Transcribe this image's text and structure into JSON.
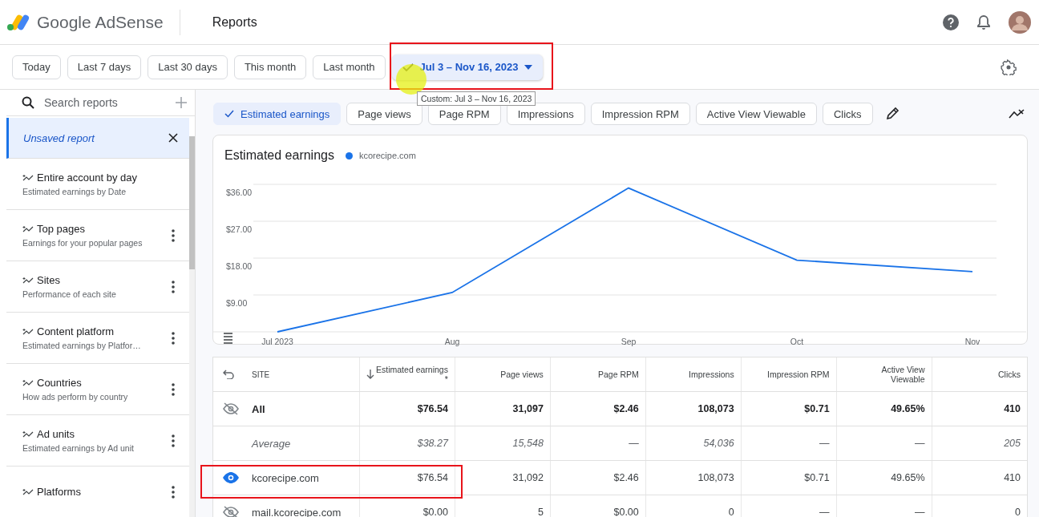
{
  "header": {
    "product_name": "Google AdSense",
    "page_title": "Reports"
  },
  "date_ranges": [
    {
      "label": "Today",
      "kind": "preset",
      "selected": false
    },
    {
      "label": "Last 7 days",
      "kind": "preset",
      "selected": false
    },
    {
      "label": "Last 30 days",
      "kind": "preset",
      "selected": false
    },
    {
      "label": "This month",
      "kind": "preset",
      "selected": false
    },
    {
      "label": "Last month",
      "kind": "preset",
      "selected": false
    },
    {
      "label": "Jul 3 – Nov 16, 2023",
      "kind": "custom",
      "selected": true
    }
  ],
  "tooltip": "Custom: Jul 3 – Nov 16, 2023",
  "sidebar": {
    "search": {
      "placeholder": "Search reports"
    },
    "items": [
      {
        "title": "Unsaved report",
        "kind": "current",
        "selected": true
      },
      {
        "title": "Entire account by day",
        "subtitle": "Estimated earnings by Date",
        "kind": "saved",
        "menu": false,
        "selected": false
      },
      {
        "title": "Top pages",
        "subtitle": "Earnings for your popular pages",
        "kind": "saved",
        "menu": true,
        "selected": false
      },
      {
        "title": "Sites",
        "subtitle": "Performance of each site",
        "kind": "saved",
        "menu": true,
        "selected": false
      },
      {
        "title": "Content platform",
        "subtitle": "Estimated earnings by Platfor…",
        "kind": "saved",
        "menu": true,
        "selected": false
      },
      {
        "title": "Countries",
        "subtitle": "How ads perform by country",
        "kind": "saved",
        "menu": true,
        "selected": false
      },
      {
        "title": "Ad units",
        "subtitle": "Estimated earnings by Ad unit",
        "kind": "saved",
        "menu": true,
        "selected": false
      },
      {
        "title": "Platforms",
        "kind": "saved",
        "menu": true,
        "selected": false
      }
    ]
  },
  "metrics": [
    {
      "label": "Estimated earnings",
      "selected": true
    },
    {
      "label": "Page views",
      "selected": false
    },
    {
      "label": "Page RPM",
      "selected": false
    },
    {
      "label": "Impressions",
      "selected": false
    },
    {
      "label": "Impression RPM",
      "selected": false
    },
    {
      "label": "Active View Viewable",
      "selected": false
    },
    {
      "label": "Clicks",
      "selected": false
    }
  ],
  "chart": {
    "title": "Estimated earnings",
    "chart_data": {
      "type": "line",
      "grid": true,
      "categories": [
        "Jul 2023",
        "Aug",
        "Sep",
        "Oct",
        "Nov"
      ],
      "series": [
        {
          "name": "kcorecipe.com",
          "color": "#1a73e8",
          "values": [
            0.0,
            9.6,
            35.1,
            17.5,
            14.7
          ]
        }
      ],
      "ylim": [
        0,
        36
      ],
      "yticks": [
        {
          "value": 9,
          "label": "$9.00"
        },
        {
          "value": 18,
          "label": "$18.00"
        },
        {
          "value": 27,
          "label": "$27.00"
        },
        {
          "value": 36,
          "label": "$36.00"
        }
      ]
    }
  },
  "table": {
    "columns": [
      "SITE",
      "Estimated earnings *",
      "Page views",
      "Page RPM",
      "Impressions",
      "Impression RPM",
      "Active View Viewable",
      "Clicks"
    ],
    "rows": [
      {
        "kind": "total",
        "visible": false,
        "cells": [
          "All",
          "$76.54",
          "31,097",
          "$2.46",
          "108,073",
          "$0.71",
          "49.65%",
          "410"
        ]
      },
      {
        "kind": "average",
        "cells": [
          "Average",
          "$38.27",
          "15,548",
          "—",
          "54,036",
          "—",
          "—",
          "205"
        ]
      },
      {
        "kind": "site",
        "visible": true,
        "cells": [
          "kcorecipe.com",
          "$76.54",
          "31,092",
          "$2.46",
          "108,073",
          "$0.71",
          "49.65%",
          "410"
        ]
      },
      {
        "kind": "site",
        "visible": false,
        "cells": [
          "mail.kcorecipe.com",
          "$0.00",
          "5",
          "$0.00",
          "0",
          "—",
          "—",
          "0"
        ]
      }
    ]
  }
}
